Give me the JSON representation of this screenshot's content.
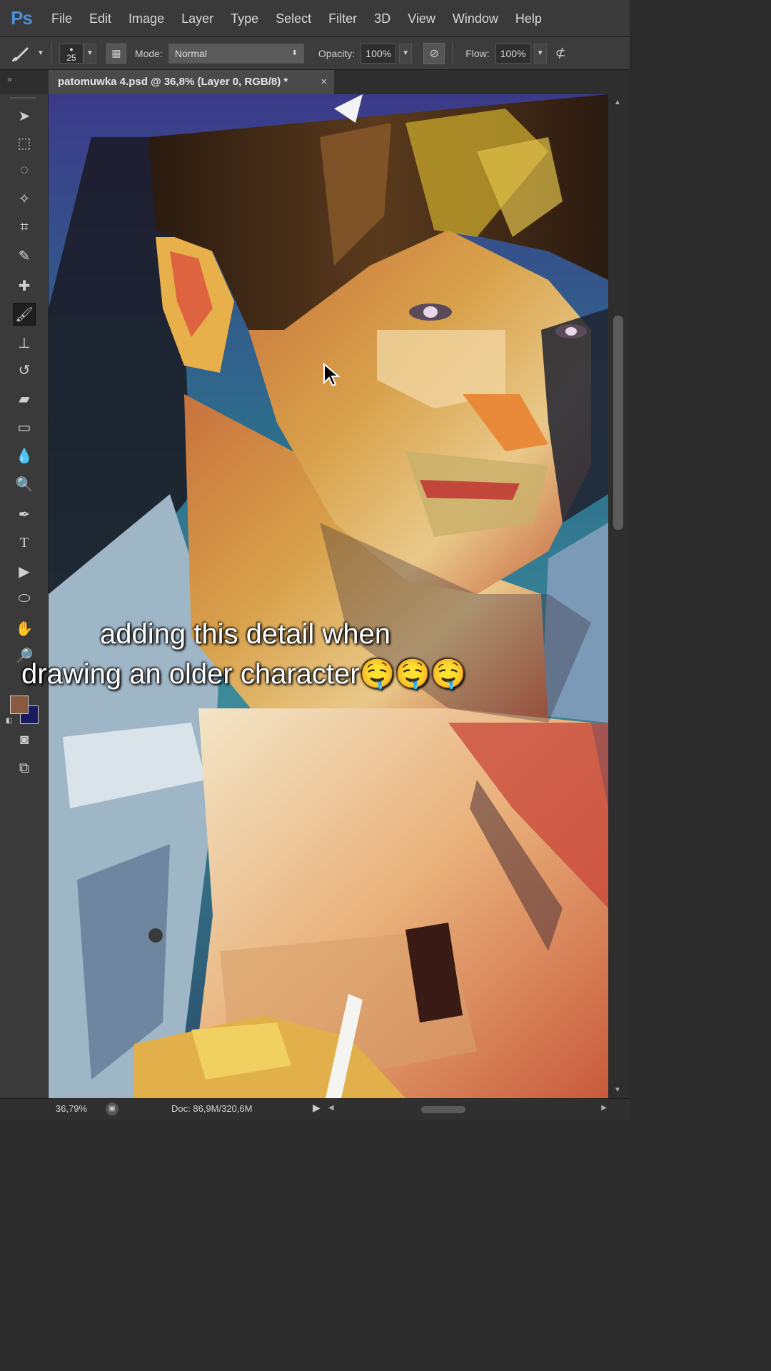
{
  "app": {
    "logo": "Ps"
  },
  "menu": [
    "File",
    "Edit",
    "Image",
    "Layer",
    "Type",
    "Select",
    "Filter",
    "3D",
    "View",
    "Window",
    "Help"
  ],
  "options": {
    "brush_size": "25",
    "mode_label": "Mode:",
    "mode_value": "Normal",
    "opacity_label": "Opacity:",
    "opacity_value": "100%",
    "flow_label": "Flow:",
    "flow_value": "100%"
  },
  "document_tab": {
    "title": "patomuwka 4.psd @ 36,8% (Layer 0, RGB/8) *",
    "close": "×"
  },
  "tools": [
    {
      "name": "move-tool-icon",
      "glyph": "➤"
    },
    {
      "name": "marquee-tool-icon",
      "glyph": "⬚"
    },
    {
      "name": "lasso-tool-icon",
      "glyph": "◌"
    },
    {
      "name": "magic-wand-tool-icon",
      "glyph": "✧"
    },
    {
      "name": "crop-tool-icon",
      "glyph": "⌗"
    },
    {
      "name": "eyedropper-tool-icon",
      "glyph": "✎"
    },
    {
      "name": "healing-brush-tool-icon",
      "glyph": "✚"
    },
    {
      "name": "brush-tool-icon",
      "glyph": "🖌"
    },
    {
      "name": "clone-stamp-tool-icon",
      "glyph": "⊥"
    },
    {
      "name": "history-brush-tool-icon",
      "glyph": "↺"
    },
    {
      "name": "eraser-tool-icon",
      "glyph": "▰"
    },
    {
      "name": "gradient-tool-icon",
      "glyph": "▭"
    },
    {
      "name": "blur-tool-icon",
      "glyph": "💧"
    },
    {
      "name": "dodge-tool-icon",
      "glyph": "🔍"
    },
    {
      "name": "pen-tool-icon",
      "glyph": "✒"
    },
    {
      "name": "type-tool-icon",
      "glyph": "T"
    },
    {
      "name": "path-selection-tool-icon",
      "glyph": "▶"
    },
    {
      "name": "ellipse-tool-icon",
      "glyph": "⬭"
    },
    {
      "name": "hand-tool-icon",
      "glyph": "✋"
    },
    {
      "name": "zoom-tool-icon",
      "glyph": "🔎"
    }
  ],
  "colors": {
    "foreground": "#8a5a40",
    "background": "#1a1a5e"
  },
  "caption": {
    "line1": "adding this detail when",
    "line2": "drawing an older character🤤🤤🤤"
  },
  "status": {
    "zoom": "36,79%",
    "doc": "Doc: 86,9M/320,6M"
  }
}
